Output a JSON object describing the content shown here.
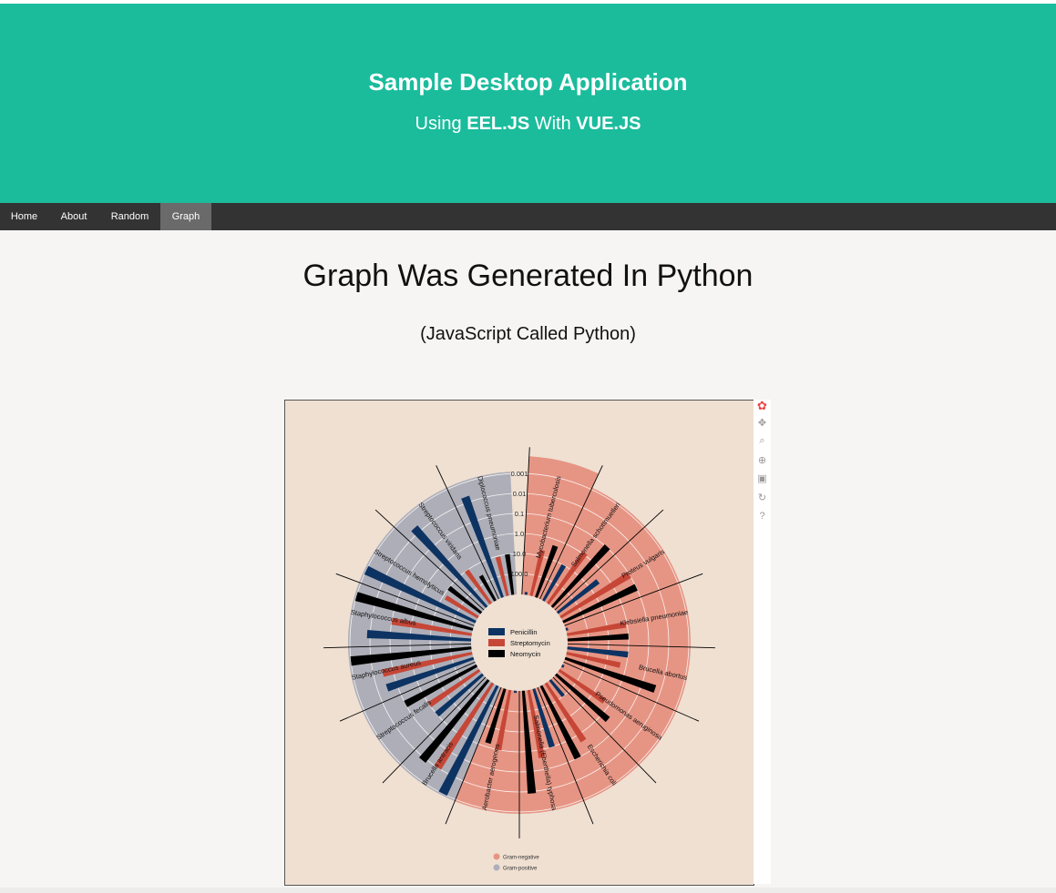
{
  "header": {
    "title": "Sample Desktop Application",
    "subtitle_prefix": "Using",
    "subtitle_lib1": "EEL.JS",
    "subtitle_mid": "With",
    "subtitle_lib2": "VUE.JS",
    "background": "#1abc9c"
  },
  "nav": {
    "items": [
      {
        "label": "Home",
        "active": false
      },
      {
        "label": "About",
        "active": false
      },
      {
        "label": "Random",
        "active": false
      },
      {
        "label": "Graph",
        "active": true
      }
    ]
  },
  "main": {
    "heading": "Graph Was Generated In Python",
    "subheading": "(JavaScript Called Python)"
  },
  "toolbar": {
    "icons": [
      "bokeh-logo-icon",
      "pan-icon",
      "box-zoom-icon",
      "wheel-zoom-icon",
      "save-icon",
      "reset-icon",
      "help-icon"
    ]
  },
  "chart_data": {
    "type": "radial-bar",
    "title": "",
    "scale_labels": [
      "0.001",
      "0.01",
      "0.1",
      "1.0",
      "10.0",
      "100.0"
    ],
    "antibiotic_legend": [
      {
        "name": "Penicillin",
        "color": "#0d3362"
      },
      {
        "name": "Streptomycin",
        "color": "#c64737"
      },
      {
        "name": "Neomycin",
        "color": "#000000"
      }
    ],
    "gram_legend": [
      {
        "name": "Gram-negative",
        "color": "#e69584"
      },
      {
        "name": "Gram-positive",
        "color": "#aeaeb8"
      }
    ],
    "bacteria": [
      {
        "name": "Mycobacterium tuberculosis",
        "gram": "negative",
        "penicillin": 800,
        "streptomycin": 5,
        "neomycin": 2
      },
      {
        "name": "Salmonella schottmuelleri",
        "gram": "negative",
        "penicillin": 10,
        "streptomycin": 0.8,
        "neomycin": 0.09
      },
      {
        "name": "Proteus vulgaris",
        "gram": "negative",
        "penicillin": 3,
        "streptomycin": 0.1,
        "neomycin": 0.1
      },
      {
        "name": "Klebsiella pneumoniae",
        "gram": "negative",
        "penicillin": 850,
        "streptomycin": 1.2,
        "neomycin": 1
      },
      {
        "name": "Brucella abortus",
        "gram": "negative",
        "penicillin": 1,
        "streptomycin": 2,
        "neomycin": 0.02
      },
      {
        "name": "Pseudomonas aeruginosa",
        "gram": "negative",
        "penicillin": 850,
        "streptomycin": 2,
        "neomycin": 0.4
      },
      {
        "name": "Escherichia coli",
        "gram": "negative",
        "penicillin": 100,
        "streptomycin": 0.4,
        "neomycin": 0.1
      },
      {
        "name": "Salmonella (Eberthella) typhosa",
        "gram": "negative",
        "penicillin": 1,
        "streptomycin": 0.4,
        "neomycin": 0.008
      },
      {
        "name": "Aerobacter aerogenes",
        "gram": "negative",
        "penicillin": 870,
        "streptomycin": 1,
        "neomycin": 1.6
      },
      {
        "name": "Brucella antracis",
        "gram": "positive",
        "penicillin": 0.001,
        "streptomycin": 0.01,
        "neomycin": 0.007
      },
      {
        "name": "Streptococcus fecalis",
        "gram": "positive",
        "penicillin": 1,
        "streptomycin": 1,
        "neomycin": 0.1
      },
      {
        "name": "Staphylococcus aureus",
        "gram": "positive",
        "penicillin": 0.03,
        "streptomycin": 0.03,
        "neomycin": 0.001
      },
      {
        "name": "Staphylococcus albus",
        "gram": "positive",
        "penicillin": 0.007,
        "streptomycin": 0.1,
        "neomycin": 0.001
      },
      {
        "name": "Streptococcus hemolyticus",
        "gram": "positive",
        "penicillin": 0.001,
        "streptomycin": 14,
        "neomycin": 10
      },
      {
        "name": "Streptococcus viridans",
        "gram": "positive",
        "penicillin": 0.005,
        "streptomycin": 10,
        "neomycin": 40
      },
      {
        "name": "Diplococcus pneumoniae",
        "gram": "positive",
        "penicillin": 0.005,
        "streptomycin": 11,
        "neomycin": 10
      }
    ]
  }
}
